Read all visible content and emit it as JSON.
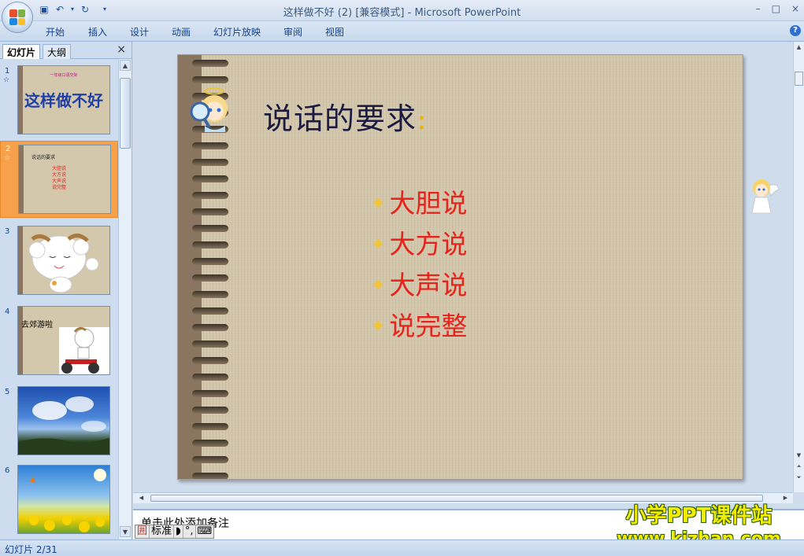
{
  "window": {
    "title": "这样做不好 (2) [兼容模式] - Microsoft PowerPoint",
    "controls": [
      "–",
      "□",
      "×"
    ]
  },
  "ribbon": {
    "tabs": [
      "开始",
      "插入",
      "设计",
      "动画",
      "幻灯片放映",
      "审阅",
      "视图"
    ]
  },
  "left_pane": {
    "tabs": [
      "幻灯片",
      "大纲"
    ],
    "close": "×",
    "thumbnails": [
      {
        "num": "1",
        "star": "☆",
        "caption": "一年级口语交际",
        "title": "这样做不好"
      },
      {
        "num": "2",
        "star": "☆",
        "caption": "说话的要求",
        "lines": [
          "大胆说",
          "大方说",
          "大声说",
          "说完整"
        ]
      },
      {
        "num": "3"
      },
      {
        "num": "4",
        "caption": "去郊游啦"
      },
      {
        "num": "5"
      },
      {
        "num": "6"
      }
    ]
  },
  "slide": {
    "title": "说话的要求",
    "title_colon": ":",
    "bullets": [
      "大胆说",
      "大方说",
      "大声说",
      "说完整"
    ],
    "colors": {
      "title": "#1b1b3f",
      "bullets": "#e8231b",
      "bullet_mark": "#f2c53a"
    }
  },
  "notes": {
    "placeholder": "单击此处添加备注"
  },
  "ime": {
    "mode": "标准"
  },
  "watermark": {
    "line1": "小学PPT课件站",
    "line2": "www.kjzhan.com"
  },
  "status": {
    "slide_info": "幻灯片 2/31"
  }
}
